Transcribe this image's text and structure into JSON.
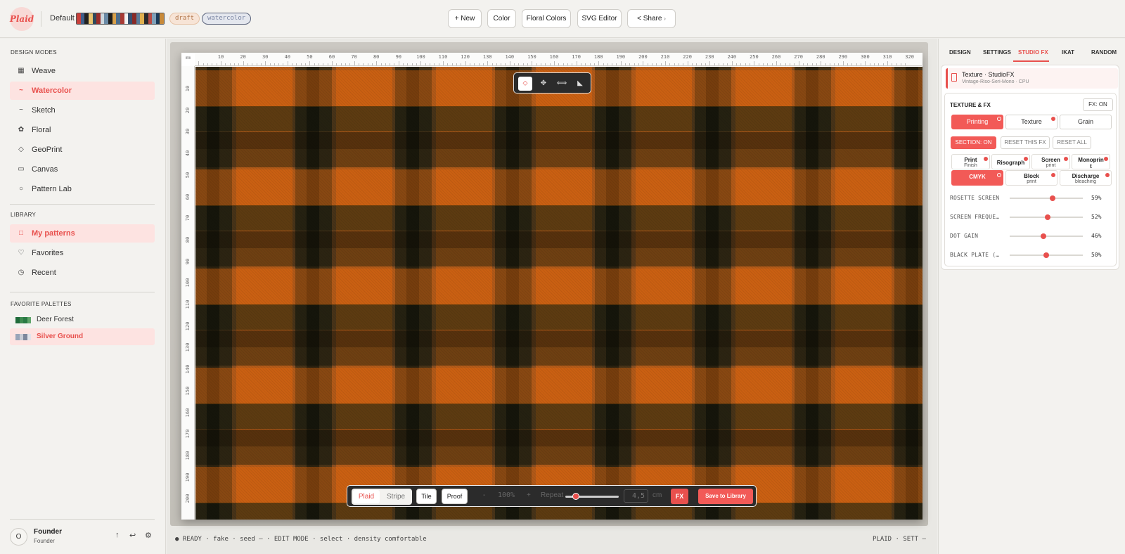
{
  "header": {
    "logo_text": "Plaid",
    "project_name": "Default",
    "palette_colors": [
      "#c9403b",
      "#3f5e8a",
      "#222222",
      "#e8c470",
      "#2e4a5c",
      "#9a2e2a",
      "#cdd7de",
      "#6a8aa6",
      "#1d1d1d",
      "#d8a04a",
      "#4c6c8c",
      "#a83a34",
      "#f2f2f2",
      "#355070",
      "#8a2a26",
      "#5a7d9a",
      "#e0b050",
      "#2b2b2b",
      "#b84a44",
      "#7fa0b8",
      "#1a3a5a",
      "#c88a3a"
    ],
    "draft_badge": "draft",
    "mode_badge": "watercolor",
    "buttons": {
      "new": "+ New",
      "color": "Color",
      "floral_colors": "Floral Colors",
      "svg_editor": "SVG Editor",
      "share": "Share",
      "share_arrow": "›"
    }
  },
  "sidebar": {
    "design_modes_title": "DESIGN MODES",
    "modes": [
      {
        "label": "Weave",
        "icon": "▦"
      },
      {
        "label": "Watercolor",
        "icon": "~"
      },
      {
        "label": "Sketch",
        "icon": "~"
      },
      {
        "label": "Floral",
        "icon": "✿"
      },
      {
        "label": "GeoPrint",
        "icon": "◇"
      },
      {
        "label": "Canvas",
        "icon": "▭"
      },
      {
        "label": "Pattern Lab",
        "icon": "○"
      }
    ],
    "library_title": "LIBRARY",
    "library": [
      {
        "label": "My patterns",
        "icon": "□"
      },
      {
        "label": "Favorites",
        "icon": "♡"
      },
      {
        "label": "Recent",
        "icon": "◷"
      }
    ],
    "palettes_title": "FAVORITE PALETTES",
    "palettes": [
      {
        "label": "Deer Forest",
        "colors": [
          "#1f6b3a",
          "#3d8a4f",
          "#2a7a44",
          "#5fa56a"
        ]
      },
      {
        "label": "Silver Ground",
        "colors": [
          "#9aa4b8",
          "#c8ccd6",
          "#7d879c",
          "#e1e3ea"
        ]
      }
    ],
    "user": {
      "avatar": "O",
      "name": "Founder",
      "role": "Founder"
    },
    "footer_icons": {
      "upload": "↑",
      "undo": "↩",
      "settings": "⚙"
    }
  },
  "ruler": {
    "unit": "mm",
    "x_ticks": [
      "10",
      "20",
      "30",
      "40",
      "50",
      "60",
      "70",
      "80",
      "90",
      "100",
      "110",
      "120",
      "130",
      "140",
      "150",
      "160",
      "170",
      "180",
      "190",
      "200",
      "210",
      "220",
      "230",
      "240",
      "250",
      "260",
      "270",
      "280",
      "290",
      "300",
      "310",
      "320"
    ],
    "y_ticks": [
      "10",
      "20",
      "30",
      "40",
      "50",
      "60",
      "70",
      "80",
      "90",
      "100",
      "110",
      "120",
      "130",
      "140",
      "150",
      "160",
      "170",
      "180",
      "190",
      "200"
    ]
  },
  "canvas_tools": {
    "select": "⬦",
    "move": "✥",
    "measure": "⟺",
    "angle": "◣"
  },
  "bottom_bar": {
    "plaid": "Plaid",
    "stripe": "Stripe",
    "tile": "Tile",
    "proof": "Proof",
    "zoom_minus": "-",
    "zoom": "100%",
    "zoom_plus": "+",
    "repeat_label": "Repeat",
    "repeat_fraction": 0.2,
    "repeat_value": "4,5",
    "repeat_unit": "cm",
    "fx": "FX",
    "save": "Save to Library"
  },
  "status": {
    "left": "● READY · fake · seed — · EDIT MODE · select · density comfortable",
    "right": "PLAID · SETT —"
  },
  "right_panel": {
    "tabs": [
      "DESIGN",
      "SETTINGS",
      "STUDIO FX",
      "IKAT",
      "RANDOM"
    ],
    "active_tab": "STUDIO FX",
    "texture_title": "Texture · StudioFX",
    "texture_sub": "Vintage-Riso-Seri-Mono · CPU",
    "section_title": "TEXTURE & FX",
    "fx_on": "FX: ON",
    "subtabs": [
      "Printing",
      "Texture",
      "Grain"
    ],
    "section_on": "SECTION: ON",
    "reset_this": "RESET THIS FX",
    "reset_all": "RESET ALL",
    "effects": [
      {
        "a": "Print",
        "b": "Finish"
      },
      {
        "a": "Risograph",
        "b": ""
      },
      {
        "a": "Screen",
        "b": "print"
      },
      {
        "a": "Monoprin",
        "b": "t"
      },
      {
        "a": "CMYK",
        "b": ""
      },
      {
        "a": "Block",
        "b": "print"
      },
      {
        "a": "Discharge",
        "b": "bleaching"
      }
    ],
    "sliders": [
      {
        "label": "ROSETTE SCREEN",
        "value": "59%",
        "fraction": 0.59
      },
      {
        "label": "SCREEN FREQUE…",
        "value": "52%",
        "fraction": 0.52
      },
      {
        "label": "DOT GAIN",
        "value": "46%",
        "fraction": 0.46
      },
      {
        "label": "BLACK PLATE (…",
        "value": "50%",
        "fraction": 0.5
      }
    ]
  }
}
